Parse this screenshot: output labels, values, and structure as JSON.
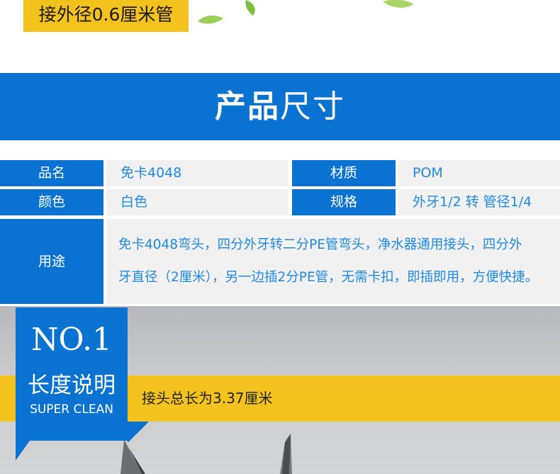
{
  "top": {
    "label": "接外径0.6厘米管"
  },
  "banner": {
    "title_bold": "产品",
    "title_light": "尺寸"
  },
  "spec": {
    "rows": [
      {
        "label1": "品名",
        "value1": "免卡4048",
        "label2": "材质",
        "value2": "POM"
      },
      {
        "label1": "颜色",
        "value1": "白色",
        "label2": "规格",
        "value2": "外牙1/2 转 管径1/4"
      }
    ],
    "usage": {
      "label": "用途",
      "line1": "免卡4048弯头，四分外牙转二分PE管弯头，净水器通用接头，四分外",
      "line2": "牙直径（2厘米），另一边插2分PE管，无需卡扣，即插即用，方便快捷。"
    }
  },
  "section": {
    "number": "NO.1",
    "title": "长度说明",
    "subtitle": "SUPER CLEAN",
    "description": "接头总长为3.37厘米"
  },
  "colors": {
    "blue": "#0a73d1",
    "yellow": "#f4c21d",
    "accent_text": "#1f8ae6"
  }
}
